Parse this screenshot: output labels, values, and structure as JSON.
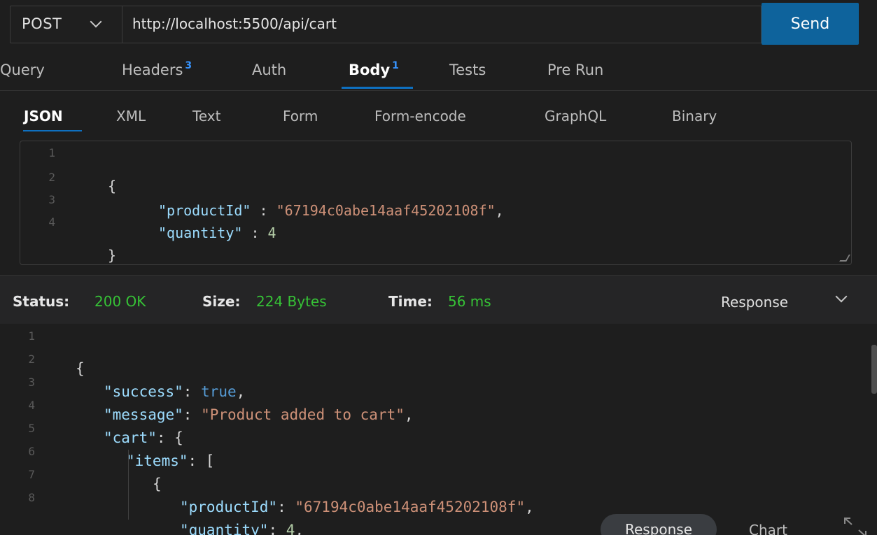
{
  "request": {
    "method": "POST",
    "url": "http://localhost:5500/api/cart",
    "send_label": "Send"
  },
  "request_tabs": [
    {
      "label": "Query",
      "badge": ""
    },
    {
      "label": "Headers",
      "badge": "3"
    },
    {
      "label": "Auth",
      "badge": ""
    },
    {
      "label": "Body",
      "badge": "1",
      "active": true
    },
    {
      "label": "Tests",
      "badge": ""
    },
    {
      "label": "Pre Run",
      "badge": ""
    }
  ],
  "body_tabs": [
    "JSON",
    "XML",
    "Text",
    "Form",
    "Form-encode",
    "GraphQL",
    "Binary"
  ],
  "body_active": "JSON",
  "editor": {
    "line_numbers": [
      "1",
      "2",
      "3",
      "4"
    ],
    "line1": "{",
    "line2_key": "\"productId\"",
    "line2_sep": " : ",
    "line2_val": "\"67194c0abe14aaf45202108f\"",
    "line2_end": ",",
    "line3_key": "\"quantity\"",
    "line3_sep": " : ",
    "line3_val": "4",
    "line4": "}"
  },
  "status": {
    "status_label": "Status:",
    "status_value": "200 OK",
    "size_label": "Size:",
    "size_value": "224 Bytes",
    "time_label": "Time:",
    "time_value": "56 ms",
    "view_select": "Response"
  },
  "response": {
    "line_numbers": [
      "1",
      "2",
      "3",
      "4",
      "5",
      "6",
      "7",
      "8"
    ],
    "l1": "{",
    "l2_key": "\"success\"",
    "l2_sep": ": ",
    "l2_val": "true",
    "l2_end": ",",
    "l3_key": "\"message\"",
    "l3_sep": ": ",
    "l3_val": "\"Product added to cart\"",
    "l3_end": ",",
    "l4_key": "\"cart\"",
    "l4_sep": ": {",
    "l5_key": "\"items\"",
    "l5_sep": ": [",
    "l6": "{",
    "l7_key": "\"productId\"",
    "l7_sep": ": ",
    "l7_val": "\"67194c0abe14aaf45202108f\"",
    "l7_end": ",",
    "l8_key": "\"quantity\"",
    "l8_sep": ": ",
    "l8_val": "4",
    "l8_end": ","
  },
  "view_toggle": {
    "response_label": "Response",
    "chart_label": "Chart"
  },
  "colors": {
    "send_bg": "#0e639c",
    "status_ok": "#36c236",
    "badge": "#3794ff"
  }
}
